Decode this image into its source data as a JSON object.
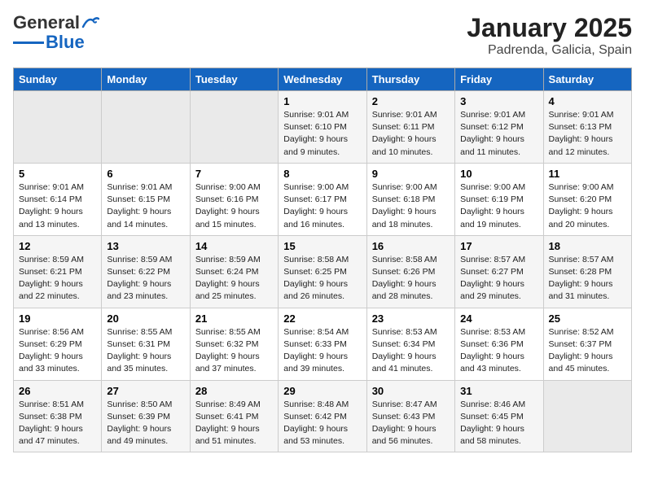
{
  "logo": {
    "line1": "General",
    "line2": "Blue"
  },
  "title": "January 2025",
  "subtitle": "Padrenda, Galicia, Spain",
  "weekdays": [
    "Sunday",
    "Monday",
    "Tuesday",
    "Wednesday",
    "Thursday",
    "Friday",
    "Saturday"
  ],
  "weeks": [
    [
      {
        "day": "",
        "empty": true
      },
      {
        "day": "",
        "empty": true
      },
      {
        "day": "",
        "empty": true
      },
      {
        "day": "1",
        "sunrise": "9:01 AM",
        "sunset": "6:10 PM",
        "daylight": "9 hours and 9 minutes."
      },
      {
        "day": "2",
        "sunrise": "9:01 AM",
        "sunset": "6:11 PM",
        "daylight": "9 hours and 10 minutes."
      },
      {
        "day": "3",
        "sunrise": "9:01 AM",
        "sunset": "6:12 PM",
        "daylight": "9 hours and 11 minutes."
      },
      {
        "day": "4",
        "sunrise": "9:01 AM",
        "sunset": "6:13 PM",
        "daylight": "9 hours and 12 minutes."
      }
    ],
    [
      {
        "day": "5",
        "sunrise": "9:01 AM",
        "sunset": "6:14 PM",
        "daylight": "9 hours and 13 minutes."
      },
      {
        "day": "6",
        "sunrise": "9:01 AM",
        "sunset": "6:15 PM",
        "daylight": "9 hours and 14 minutes."
      },
      {
        "day": "7",
        "sunrise": "9:00 AM",
        "sunset": "6:16 PM",
        "daylight": "9 hours and 15 minutes."
      },
      {
        "day": "8",
        "sunrise": "9:00 AM",
        "sunset": "6:17 PM",
        "daylight": "9 hours and 16 minutes."
      },
      {
        "day": "9",
        "sunrise": "9:00 AM",
        "sunset": "6:18 PM",
        "daylight": "9 hours and 18 minutes."
      },
      {
        "day": "10",
        "sunrise": "9:00 AM",
        "sunset": "6:19 PM",
        "daylight": "9 hours and 19 minutes."
      },
      {
        "day": "11",
        "sunrise": "9:00 AM",
        "sunset": "6:20 PM",
        "daylight": "9 hours and 20 minutes."
      }
    ],
    [
      {
        "day": "12",
        "sunrise": "8:59 AM",
        "sunset": "6:21 PM",
        "daylight": "9 hours and 22 minutes."
      },
      {
        "day": "13",
        "sunrise": "8:59 AM",
        "sunset": "6:22 PM",
        "daylight": "9 hours and 23 minutes."
      },
      {
        "day": "14",
        "sunrise": "8:59 AM",
        "sunset": "6:24 PM",
        "daylight": "9 hours and 25 minutes."
      },
      {
        "day": "15",
        "sunrise": "8:58 AM",
        "sunset": "6:25 PM",
        "daylight": "9 hours and 26 minutes."
      },
      {
        "day": "16",
        "sunrise": "8:58 AM",
        "sunset": "6:26 PM",
        "daylight": "9 hours and 28 minutes."
      },
      {
        "day": "17",
        "sunrise": "8:57 AM",
        "sunset": "6:27 PM",
        "daylight": "9 hours and 29 minutes."
      },
      {
        "day": "18",
        "sunrise": "8:57 AM",
        "sunset": "6:28 PM",
        "daylight": "9 hours and 31 minutes."
      }
    ],
    [
      {
        "day": "19",
        "sunrise": "8:56 AM",
        "sunset": "6:29 PM",
        "daylight": "9 hours and 33 minutes."
      },
      {
        "day": "20",
        "sunrise": "8:55 AM",
        "sunset": "6:31 PM",
        "daylight": "9 hours and 35 minutes."
      },
      {
        "day": "21",
        "sunrise": "8:55 AM",
        "sunset": "6:32 PM",
        "daylight": "9 hours and 37 minutes."
      },
      {
        "day": "22",
        "sunrise": "8:54 AM",
        "sunset": "6:33 PM",
        "daylight": "9 hours and 39 minutes."
      },
      {
        "day": "23",
        "sunrise": "8:53 AM",
        "sunset": "6:34 PM",
        "daylight": "9 hours and 41 minutes."
      },
      {
        "day": "24",
        "sunrise": "8:53 AM",
        "sunset": "6:36 PM",
        "daylight": "9 hours and 43 minutes."
      },
      {
        "day": "25",
        "sunrise": "8:52 AM",
        "sunset": "6:37 PM",
        "daylight": "9 hours and 45 minutes."
      }
    ],
    [
      {
        "day": "26",
        "sunrise": "8:51 AM",
        "sunset": "6:38 PM",
        "daylight": "9 hours and 47 minutes."
      },
      {
        "day": "27",
        "sunrise": "8:50 AM",
        "sunset": "6:39 PM",
        "daylight": "9 hours and 49 minutes."
      },
      {
        "day": "28",
        "sunrise": "8:49 AM",
        "sunset": "6:41 PM",
        "daylight": "9 hours and 51 minutes."
      },
      {
        "day": "29",
        "sunrise": "8:48 AM",
        "sunset": "6:42 PM",
        "daylight": "9 hours and 53 minutes."
      },
      {
        "day": "30",
        "sunrise": "8:47 AM",
        "sunset": "6:43 PM",
        "daylight": "9 hours and 56 minutes."
      },
      {
        "day": "31",
        "sunrise": "8:46 AM",
        "sunset": "6:45 PM",
        "daylight": "9 hours and 58 minutes."
      },
      {
        "day": "",
        "empty": true
      }
    ]
  ]
}
